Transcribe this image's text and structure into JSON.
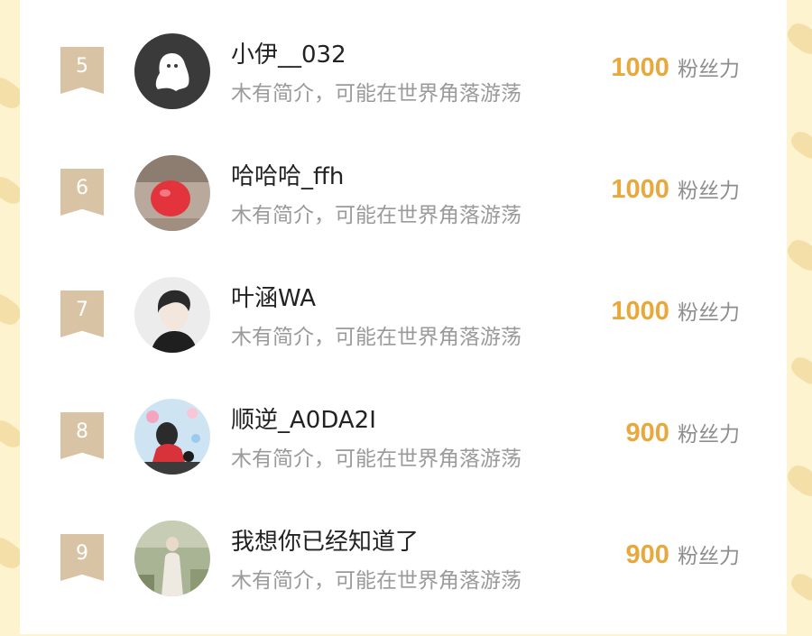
{
  "leaderboard": [
    {
      "rank": "5",
      "username": "小伊__032",
      "bio": "木有简介，可能在世界角落游荡",
      "fans_count": "1000",
      "fans_unit": "粉丝力"
    },
    {
      "rank": "6",
      "username": "哈哈哈_ffh",
      "bio": "木有简介，可能在世界角落游荡",
      "fans_count": "1000",
      "fans_unit": "粉丝力"
    },
    {
      "rank": "7",
      "username": "叶涵WA",
      "bio": "木有简介，可能在世界角落游荡",
      "fans_count": "1000",
      "fans_unit": "粉丝力"
    },
    {
      "rank": "8",
      "username": "顺逆_A0DA2I",
      "bio": "木有简介，可能在世界角落游荡",
      "fans_count": "900",
      "fans_unit": "粉丝力"
    },
    {
      "rank": "9",
      "username": "我想你已经知道了",
      "bio": "木有简介，可能在世界角落游荡",
      "fans_count": "900",
      "fans_unit": "粉丝力"
    }
  ],
  "colors": {
    "page_background": "#fdf3cf",
    "rank_badge": "#d9c3a5",
    "fans_count": "#e9a83c",
    "bio_text": "#9a9a9a"
  }
}
